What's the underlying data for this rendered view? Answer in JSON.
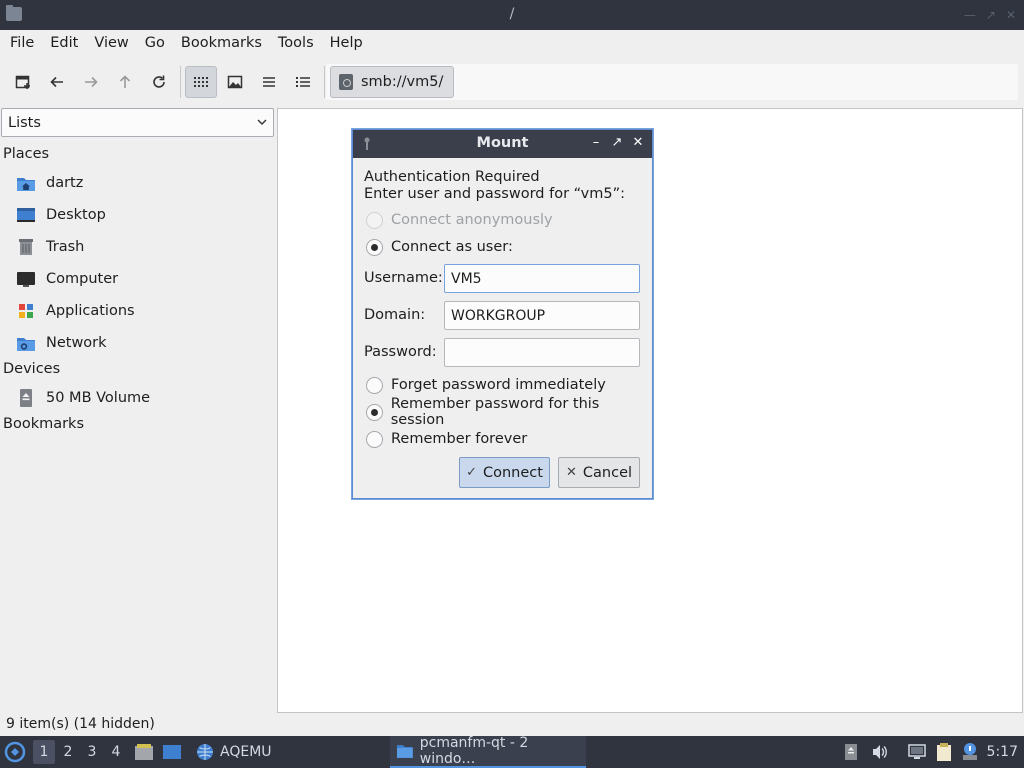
{
  "window": {
    "title": "/"
  },
  "menubar": [
    "File",
    "Edit",
    "View",
    "Go",
    "Bookmarks",
    "Tools",
    "Help"
  ],
  "toolbar": {
    "path": "smb://vm5/"
  },
  "side_panel": {
    "selector": "Lists",
    "places_heading": "Places",
    "places": [
      {
        "label": "dartz",
        "icon": "home-folder-icon"
      },
      {
        "label": "Desktop",
        "icon": "desktop-icon"
      },
      {
        "label": "Trash",
        "icon": "trash-icon"
      },
      {
        "label": "Computer",
        "icon": "computer-icon"
      },
      {
        "label": "Applications",
        "icon": "applications-icon"
      },
      {
        "label": "Network",
        "icon": "network-icon"
      }
    ],
    "devices_heading": "Devices",
    "devices": [
      {
        "label": "50 MB Volume",
        "icon": "drive-eject-icon"
      }
    ],
    "bookmarks_heading": "Bookmarks"
  },
  "status": "9 item(s) (14 hidden)",
  "dialog": {
    "title": "Mount",
    "line1": "Authentication Required",
    "line2": "Enter user and password for “vm5”:",
    "connect_anonymously": "Connect anonymously",
    "connect_as_user": "Connect as user:",
    "username_label": "Username:",
    "username_value": "VM5",
    "domain_label": "Domain:",
    "domain_value": "WORKGROUP",
    "password_label": "Password:",
    "password_value": "",
    "forget_password": "Forget password immediately",
    "remember_session": "Remember password for this session",
    "remember_forever": "Remember forever",
    "connect_button": "Connect",
    "cancel_button": "Cancel"
  },
  "taskbar": {
    "desktops": [
      "1",
      "2",
      "3",
      "4"
    ],
    "qemu_label": "AQEMU",
    "task_label": "pcmanfm-qt - 2 windo…",
    "clock": "5:17"
  }
}
